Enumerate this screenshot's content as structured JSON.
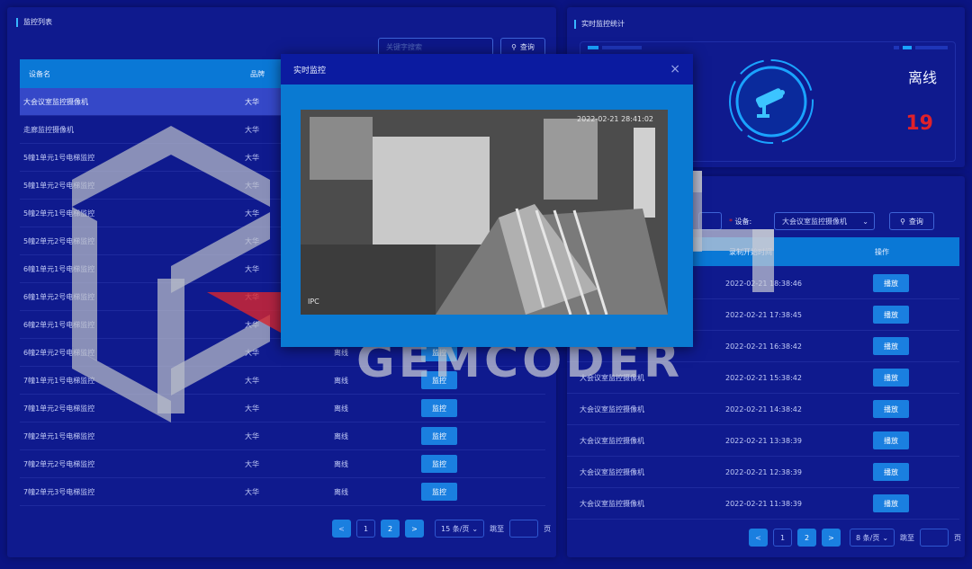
{
  "left_panel": {
    "title": "监控列表",
    "search_placeholder": "关键字搜索",
    "search_button": "查询",
    "columns": [
      "设备名",
      "品牌"
    ],
    "rows": [
      {
        "name": "大会议室监控摄像机",
        "brand": "大华",
        "status": "",
        "action": ""
      },
      {
        "name": "走廊监控摄像机",
        "brand": "大华",
        "status": "",
        "action": ""
      },
      {
        "name": "5幢1单元1号电梯监控",
        "brand": "大华",
        "status": "",
        "action": ""
      },
      {
        "name": "5幢1单元2号电梯监控",
        "brand": "大华",
        "status": "",
        "action": ""
      },
      {
        "name": "5幢2单元1号电梯监控",
        "brand": "大华",
        "status": "",
        "action": ""
      },
      {
        "name": "5幢2单元2号电梯监控",
        "brand": "大华",
        "status": "",
        "action": ""
      },
      {
        "name": "6幢1单元1号电梯监控",
        "brand": "大华",
        "status": "",
        "action": ""
      },
      {
        "name": "6幢1单元2号电梯监控",
        "brand": "大华",
        "status": "",
        "action": ""
      },
      {
        "name": "6幢2单元1号电梯监控",
        "brand": "大华",
        "status": "",
        "action": ""
      },
      {
        "name": "6幢2单元2号电梯监控",
        "brand": "大华",
        "status": "离线",
        "action": "监控"
      },
      {
        "name": "7幢1单元1号电梯监控",
        "brand": "大华",
        "status": "离线",
        "action": "监控"
      },
      {
        "name": "7幢1单元2号电梯监控",
        "brand": "大华",
        "status": "离线",
        "action": "监控"
      },
      {
        "name": "7幢2单元1号电梯监控",
        "brand": "大华",
        "status": "离线",
        "action": "监控"
      },
      {
        "name": "7幢2单元2号电梯监控",
        "brand": "大华",
        "status": "离线",
        "action": "监控"
      },
      {
        "name": "7幢2单元3号电梯监控",
        "brand": "大华",
        "status": "离线",
        "action": "监控"
      }
    ],
    "pager": {
      "prev": "<",
      "pages": [
        "1",
        "2"
      ],
      "next": ">",
      "size": "15 条/页",
      "jump_label": "跳至",
      "page_suffix": "页"
    }
  },
  "stats_panel": {
    "title": "实时监控统计",
    "offline_label": "离线",
    "offline_count": "19",
    "accent": "#e0212a"
  },
  "records_panel": {
    "device_label": "设备:",
    "device_value": "大会议室监控摄像机",
    "search_button": "查询",
    "columns": [
      "录制开始时间",
      "操作"
    ],
    "rows": [
      {
        "device": "",
        "time": "2022-02-21 18:38:46",
        "action": "播放"
      },
      {
        "device": "",
        "time": "2022-02-21 17:38:45",
        "action": "播放"
      },
      {
        "device": "",
        "time": "2022-02-21 16:38:42",
        "action": "播放"
      },
      {
        "device": "大会议室监控摄像机",
        "time": "2022-02-21 15:38:42",
        "action": "播放"
      },
      {
        "device": "大会议室监控摄像机",
        "time": "2022-02-21 14:38:42",
        "action": "播放"
      },
      {
        "device": "大会议室监控摄像机",
        "time": "2022-02-21 13:38:39",
        "action": "播放"
      },
      {
        "device": "大会议室监控摄像机",
        "time": "2022-02-21 12:38:39",
        "action": "播放"
      },
      {
        "device": "大会议室监控摄像机",
        "time": "2022-02-21 11:38:39",
        "action": "播放"
      }
    ],
    "pager": {
      "prev": "<",
      "pages": [
        "1",
        "2"
      ],
      "next": ">",
      "size": "8 条/页",
      "jump_label": "跳至",
      "page_suffix": "页"
    }
  },
  "modal": {
    "title": "实时监控",
    "close": "×",
    "video_timestamp": "2022-02-21 28:41:02",
    "video_label": "IPC"
  },
  "watermark": {
    "text": "GEMCODER"
  }
}
